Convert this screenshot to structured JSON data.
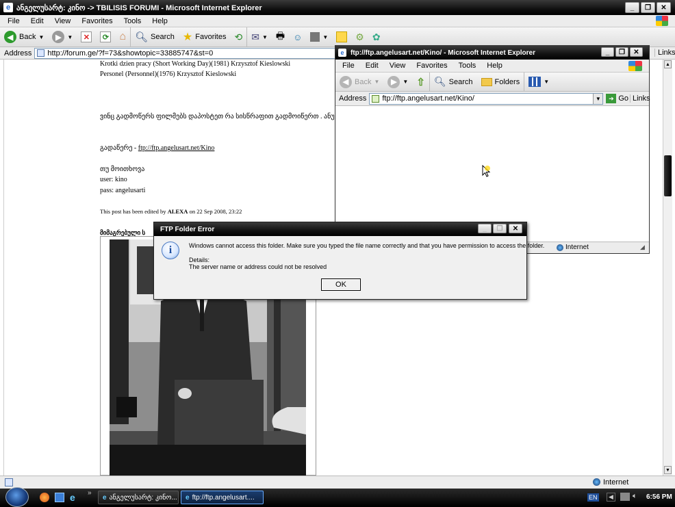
{
  "main_window": {
    "title": "ანგელუსარტ: კინო -> TBILISIS FORUMI - Microsoft Internet Explorer",
    "menu": [
      "File",
      "Edit",
      "View",
      "Favorites",
      "Tools",
      "Help"
    ],
    "toolbar": {
      "back": "Back",
      "search": "Search",
      "favorites": "Favorites"
    },
    "address_label": "Address",
    "address_url": "http://forum.ge/?f=73&showtopic=33885747&st=0",
    "links_label": "Links",
    "status_zone": "Internet"
  },
  "forum_post": {
    "line1": "Krotki dzien pracy (Short Working Day)(1981) Krzysztof Kieslowski",
    "line2": "Personel (Personnel)(1976) Krzysztof Kieslowski",
    "line3": "ვინც გადმოწერს ფილმებს დაპოსტეთ რა სისწრაფით გადმოიწერთ . ანუ",
    "download_prefix": "გადაწერე - ",
    "download_link": "ftp://ftp.angelusart.net/Kino",
    "note": "თუ მოითხოვა",
    "user": "user: kino",
    "pass": "pass: angelusarti",
    "edited_prefix": "This post has been edited by ",
    "edited_author": "ALEXA",
    "edited_suffix": " on 22 Sep 2008, 23:22",
    "attach_label": "მიმაგრებული ს"
  },
  "ftp_window": {
    "title": "ftp://ftp.angelusart.net/Kino/ - Microsoft Internet Explorer",
    "menu": [
      "File",
      "Edit",
      "View",
      "Favorites",
      "Tools",
      "Help"
    ],
    "toolbar": {
      "back": "Back",
      "search": "Search",
      "folders": "Folders"
    },
    "address_label": "Address",
    "address_url": "ftp://ftp.angelusart.net/Kino/",
    "go_label": "Go",
    "links_label": "Links",
    "status_zone": "Internet"
  },
  "dialog": {
    "title": "FTP Folder Error",
    "message": "Windows cannot access this folder. Make sure you typed the file name correctly and that you have permission to access the folder.",
    "details_label": "Details:",
    "details_text": "The server name or address could not be resolved",
    "ok_label": "OK"
  },
  "taskbar": {
    "task1": "ანგელუსარტ: კინო...",
    "task2": "ftp://ftp.angelusart....",
    "lang": "EN",
    "clock": "6:56 PM"
  }
}
